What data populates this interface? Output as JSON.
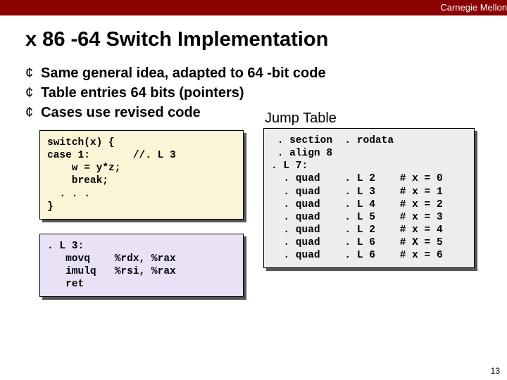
{
  "header": {
    "brand": "Carnegie Mellon"
  },
  "title": "x 86 -64 Switch Implementation",
  "bullets": [
    "Same general idea, adapted to 64 -bit code",
    "Table entries 64 bits (pointers)",
    "Cases use revised code"
  ],
  "jump_label": "Jump Table",
  "code_switch": "switch(x) {\ncase 1:       //. L 3\n    w = y*z;\n    break;\n  . . .\n}",
  "code_asm": ". L 3:\n   movq    %rdx, %rax\n   imulq   %rsi, %rax\n   ret",
  "code_jump": " . section  . rodata\n . align 8\n. L 7:\n  . quad    . L 2    # x = 0\n  . quad    . L 3    # x = 1\n  . quad    . L 4    # x = 2\n  . quad    . L 5    # x = 3\n  . quad    . L 2    # x = 4\n  . quad    . L 6    # X = 5\n  . quad    . L 6    # x = 6",
  "page_number": "13"
}
